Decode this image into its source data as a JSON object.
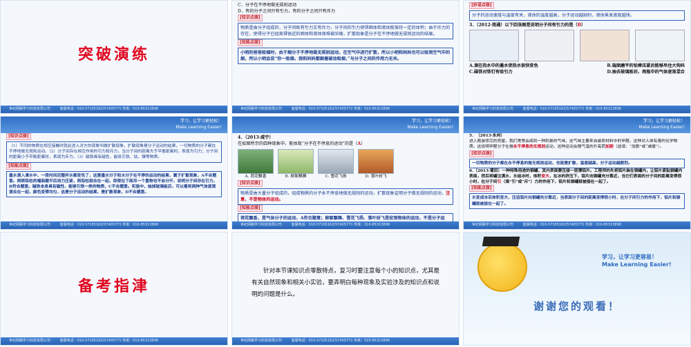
{
  "common": {
    "footer_company": "世纪网路学习科技有限公司",
    "footer_contact": "客服电话：010-57105162/57405771    传真：010-85313898",
    "slogan_cn": "学习，让学习更轻松！",
    "slogan_en": "Make Learning Easier!"
  },
  "s1": {
    "title": "突破演练"
  },
  "s2": {
    "opt_c": "C．分子在不停地做无规则运动",
    "opt_d": "D．有的分子之间只有引力，有的分子之间只有斥力",
    "tag1": "[知识点拨]",
    "box1": "物质是由分子组成的，分子间既有引力又有斥力，分子间的引力使得固体和液体能保持一定的体积；由于斥力的存在，使得分子已经离得很近的固体和液体很难被压缩，扩散现象是分子在不停地做无规则运动的结果。",
    "tag2": "[知能点拨]",
    "box2": "小明的爸爸吸烟时，由于烟分子不停地做无规则运动，在空气中进行扩散，所以小明和妈妈也可以吸到空气中的烟，所以小明会说“你一吸烟，我和妈妈都跟着被动吸烟，”与分子之间的作用力无关。"
  },
  "s3": {
    "tag": "[妙语点拨]",
    "text": "分子的运动速度与温度有关，液体的温度越高，分子运动越剧烈，液体蒸发速度越快。",
    "q": "3．（2012·南通）以下四张图是说明分子间有引力的是（",
    "q_ans": "B",
    "q_end": "）",
    "opt_a": "A.滴在热水中的墨水使热水很快变色",
    "opt_b": "B.端面磨平的铅棒压紧后能够吊住大钩码",
    "opt_c": "C.磁铁对铁钉有吸引力",
    "opt_d": "D.抽去玻璃板后，两瓶中的气体逐渐混合"
  },
  "s4": {
    "tag": "[知识点拨]",
    "box": "（1）不同的物质在相互接触时就此进入对方的现象叫做扩散现象，扩散现象是分子运动的结果，一切物质的分子都在不停地做无规则运动。（2）分子间存在相互作用的引力和斥力，当分子间的距离大于平衡距离时，表现为引力；分子间的距离小于平衡距离时，表现为斥力。（3）磁铁具有磁性，能吸引铁、钴、镍等物质。",
    "tag2": "[知能点拨]",
    "box2": "墨水滴入清水中，一段时间后整杯水都变色了，这是墨水分子和水分子在不停的运动的结果，属于扩散现象，A不合题意。两根铅柱的端面磨平后用力压紧，两铅柱就合在一起，即使在下面吊一个重物也不会分开，说明分子间存在引力，B符合题意。磁铁本身具有磁性，能够引铁一类的物质，C不合题意。实验中，抽掉玻璃板后，可以看到两种气体逐渐混合在一起，颜色变得均匀，这是分子运动的结果，是扩散现象，D不合题意。"
  },
  "s5": {
    "q": "4．（2013·咸宁）",
    "stem": "在如图所示的四种现象中，能体现“分子在不停息的运动”的是（",
    "stem_ans": "A",
    "stem_end": "）",
    "captions": [
      "A. 荷花飘香",
      "B. 柳絮飘舞",
      "C. 雪花飞扬",
      "D. 落叶纷飞"
    ],
    "tag": "[知识点拨]",
    "box": "物质是由大量分子组成的，组成物质的分子永不停息地做无规则的运动，扩散现象证明分子做无规则的运动，",
    "box_red": "注意，不是物体的运动。",
    "tag2": "[知能点拨]",
    "box2": "荷花飘香，是气体分子的运动，A符合题意；柳絮飘舞、雪花飞扬、落叶纷飞是宏观物体的运动，不是分子运动，所以BCD都不合题意。"
  },
  "s6": {
    "q": "5．（2013·永州）",
    "stem": "进入刚装修完的房屋，我们常常会闻到一种刺鼻的气味，这气味主要来自装修材料中的甲醛，这种对人体有害的化学物质。这说明甲醛分子在做",
    "blank1": "永不停息的无规则",
    "stem2": "运动，这种运动会随气温的升高而",
    "blank2": "加剧",
    "stem3": "（选填：“加剧”或“减缓”）。",
    "tag": "[知识点拨]",
    "box": "一切物质的分子都在永不停息的做无规则运动，也就是扩散，温度越高，分子运动越剧烈。",
    "q6": "6.（2013·莆田）一种特殊用途的钢罐，其内表面要压接一层薄铝片。工程师的先将铝片装在钢罐内，让铝片紧贴钢罐内表面，然后将罐注满水，水结冰时，体积",
    "blank3": "变大",
    "q6b": "，在冰的挤压下，铝片向钢罐充分靠近，当它们表面的分子间的距离变得很小时，在分子间",
    "blank4": "引",
    "q6c": "（填“引”或“斥”）力的作用下，铝片和钢罐就被接在一起了。",
    "tag2": "[知能点拨]",
    "box2": "水变成冰后体积变大，压迫铝片向钢罐充分靠近，当表面分子间的距离变得很小时，在分子间引力的作用下，铝片和钢罐就被接在一起了。"
  },
  "s7": {
    "title": "备考指津"
  },
  "s8": {
    "text": "针对本节课知识点零散特点，复习时要注意每个小的知识点，尤其是有关自然现象和相关小实验，要弄明白每种现象及实验涉及的知识点和说明的问题是什么。"
  },
  "s9": {
    "slogan_cn": "学习，让学习更容易！",
    "slogan_en": "Make Learning Easier!",
    "thanks": "谢谢您的观看！"
  }
}
